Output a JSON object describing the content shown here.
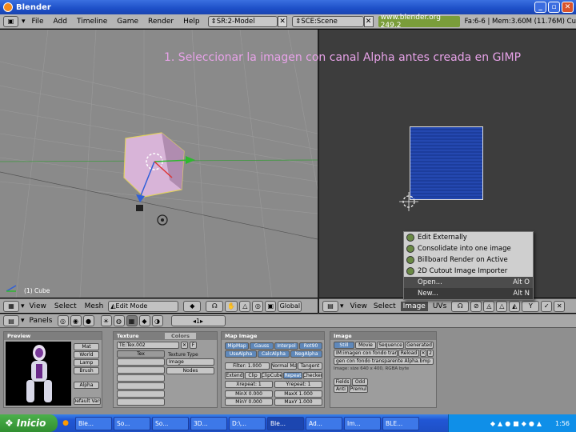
{
  "window": {
    "title": "Blender"
  },
  "menubar": {
    "items": [
      "File",
      "Add",
      "Timeline",
      "Game",
      "Render",
      "Help"
    ],
    "screen": "SR:2-Model",
    "scene": "SCE:Scene",
    "url": "www.blender.org 249.2",
    "status": "Fa:6-6 | Mem:3.60M (11.76M) Cu"
  },
  "viewport": {
    "object_label": "(1) Cube",
    "instruction": "1. Seleccionar la imagen con canal Alpha antes creada en GIMP"
  },
  "header3d": {
    "view": "View",
    "select": "Select",
    "mesh": "Mesh",
    "mode": "Edit Mode",
    "orientation": "Global"
  },
  "header_image": {
    "view": "View",
    "select": "Select",
    "image": "Image",
    "uvs": "UVs"
  },
  "image_menu": [
    {
      "label": "Edit Externally",
      "shortcut": ""
    },
    {
      "label": "Consolidate into one image",
      "shortcut": ""
    },
    {
      "label": "Billboard Render on Active",
      "shortcut": ""
    },
    {
      "label": "2D Cutout Image Importer",
      "shortcut": ""
    },
    {
      "label": "Open...",
      "shortcut": "Alt O"
    },
    {
      "label": "New...",
      "shortcut": "Alt N"
    }
  ],
  "buttons_header": {
    "panels": "Panels",
    "frame": "1"
  },
  "preview_panel": {
    "title": "Preview",
    "buttons": [
      "Mat",
      "World",
      "Lamp",
      "Brush",
      "Alpha",
      "Default Vars"
    ]
  },
  "texture_panel": {
    "title": "Texture",
    "tab2": "Colors",
    "name": "TE:Tex.002",
    "f": "F",
    "tex_label": "Tex",
    "type_label": "Texture Type",
    "type_value": "Image",
    "nodes": "Nodes"
  },
  "mapimage_panel": {
    "title": "Map Image",
    "row1": [
      "MipMap",
      "Gauss",
      "Interpol",
      "Rot90"
    ],
    "row2": [
      "UseAlpha",
      "CalcAlpha",
      "NegAlpha"
    ],
    "filter": "Filter: 1.000",
    "normal": "Normal Ma",
    "tangent": "Tangent",
    "row4": [
      "Extend",
      "Clip",
      "ClipCube",
      "Repeat",
      "Checker"
    ],
    "xrepeat": "Xrepeat: 1",
    "yrepeat": "Yrepeat: 1",
    "minx": "MinX 0.000",
    "maxx": "MaxX 1.000",
    "miny": "MinY 0.000",
    "maxy": "MaxY 1.000"
  },
  "image_panel": {
    "title": "Image",
    "tabs": [
      "Still",
      "Movie",
      "Sequence",
      "Generated"
    ],
    "imname": "IM:imagen con fondo tran",
    "reload": "Reload",
    "users": "2",
    "path": "gen con fondo transparente Alpha.bmp",
    "info": "Image: size 640 x 400, RGBA byte",
    "fields": "Fields",
    "odd": "Odd",
    "anti": "Anti",
    "premul": "Premul"
  },
  "taskbar": {
    "start": "Inicio",
    "items": [
      "Ble...",
      "So...",
      "So...",
      "3D...",
      "D:\\...",
      "Ble...",
      "Ad...",
      "Im...",
      "BLE..."
    ],
    "clock": "1:56"
  },
  "colors": {
    "accent_image": "#1e46a8",
    "title_bar": "#1d4fc7",
    "instruction_text": "#e7a2e8"
  }
}
